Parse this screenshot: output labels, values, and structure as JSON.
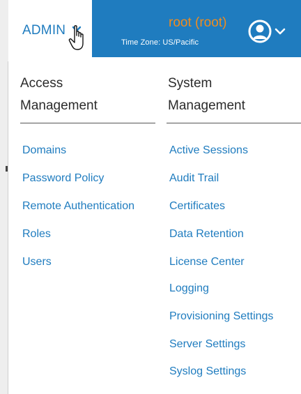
{
  "header": {
    "admin_label": "ADMIN",
    "user_label": "root (root)",
    "timezone": "Time Zone: US/Pacific",
    "icons": [
      "chevron-down-icon",
      "hand-cursor-icon",
      "user-avatar-icon"
    ],
    "colors": {
      "brand_blue": "#1f7cbf",
      "user_orange": "#f08c1e"
    }
  },
  "menu": {
    "access": {
      "heading_line1": "Access",
      "heading_line2": "Management",
      "items": [
        "Domains",
        "Password Policy",
        "Remote Authentication",
        "Roles",
        "Users"
      ]
    },
    "system": {
      "heading_line1": "System",
      "heading_line2": "Management",
      "items": [
        "Active Sessions",
        "Audit Trail",
        "Certificates",
        "Data Retention",
        "License Center",
        "Logging",
        "Provisioning Settings",
        "Server Settings",
        "Syslog Settings"
      ]
    }
  }
}
